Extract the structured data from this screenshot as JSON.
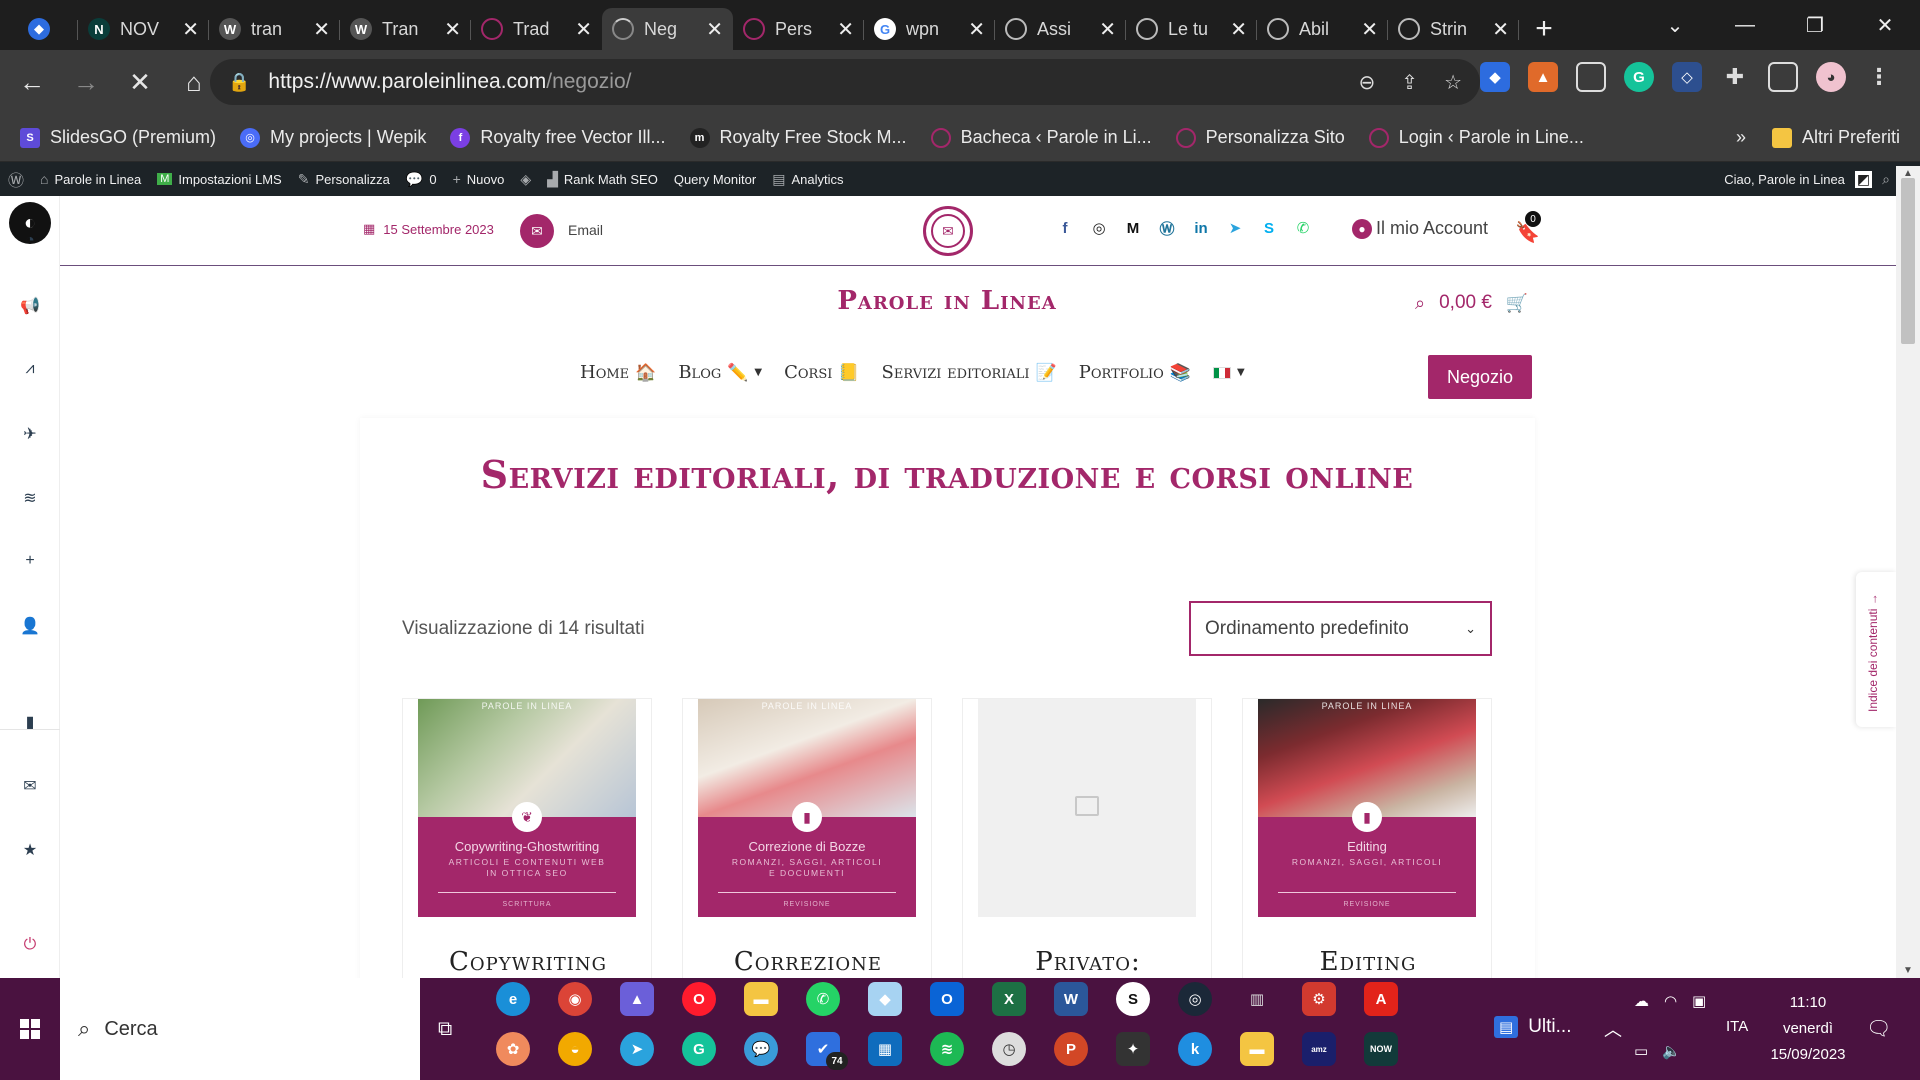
{
  "browser": {
    "tabs": [
      {
        "title": "",
        "icon": "gem-icon",
        "color": "#2d6cdf"
      },
      {
        "title": "NOV",
        "icon": "notion-n-icon",
        "color": "#0a3d3a"
      },
      {
        "title": "tran",
        "icon": "wordpress-icon",
        "color": "#555"
      },
      {
        "title": "Tran",
        "icon": "wordpress-icon",
        "color": "#555"
      },
      {
        "title": "Trad",
        "icon": "parole-logo-icon",
        "color": "#a3276a"
      },
      {
        "title": "Neg",
        "icon": "loading-spinner-icon",
        "color": "#777",
        "active": true
      },
      {
        "title": "Pers",
        "icon": "parole-logo-icon",
        "color": "#a3276a"
      },
      {
        "title": "wpn",
        "icon": "google-icon",
        "color": "#4285f4"
      },
      {
        "title": "Assi",
        "icon": "openai-icon",
        "color": "#444"
      },
      {
        "title": "Le tu",
        "icon": "openai-icon",
        "color": "#444"
      },
      {
        "title": "Abil",
        "icon": "openai-icon",
        "color": "#444"
      },
      {
        "title": "Strin",
        "icon": "openai-icon",
        "color": "#444"
      }
    ],
    "url_host": "https://www.paroleinlinea.com",
    "url_path": "/negozio/",
    "bookmarks": [
      {
        "label": "SlidesGO (Premium)",
        "color": "#5e4bd8"
      },
      {
        "label": "My projects | Wepik",
        "color": "#4a6cf7"
      },
      {
        "label": "Royalty free Vector Ill...",
        "color": "#7b3fe4"
      },
      {
        "label": "Royalty Free Stock M...",
        "color": "#222"
      },
      {
        "label": "Bacheca ‹ Parole in Li...",
        "color": "#a3276a"
      },
      {
        "label": "Personalizza Sito",
        "color": "#a3276a"
      },
      {
        "label": "Login ‹ Parole in Line...",
        "color": "#a3276a"
      }
    ],
    "bookmarks_overflow": "»",
    "other_bookmarks": "Altri Preferiti"
  },
  "wpbar": {
    "site": "Parole in Linea",
    "lms": "Impostazioni LMS",
    "customize": "Personalizza",
    "comments": "0",
    "new": "Nuovo",
    "rankmath": "Rank Math SEO",
    "querymonitor": "Query Monitor",
    "analytics": "Analytics",
    "greeting": "Ciao, Parole in Linea"
  },
  "site": {
    "date": "15 Settembre 2023",
    "email": "Email",
    "account": "Il mio Account",
    "wishlist_count": "0",
    "brand": "Parole in Linea",
    "cart_amount": "0,00 €",
    "nav": [
      {
        "label": "Home",
        "emoji": "🏠"
      },
      {
        "label": "Blog",
        "emoji": "✏️",
        "dropdown": true
      },
      {
        "label": "Corsi",
        "emoji": "📒"
      },
      {
        "label": "Servizi editoriali",
        "emoji": "📝"
      },
      {
        "label": "Portfolio",
        "emoji": "📚"
      }
    ],
    "shop_button": "Negozio",
    "page_title": "Servizi editoriali, di traduzione e corsi online",
    "results": "Visualizzazione di 14 risultati",
    "sort_selected": "Ordinamento predefinito",
    "toc_label": "Indice dei contenuti",
    "products": [
      {
        "name": "Copywriting",
        "img_brand": "PAROLE IN LINEA",
        "img_title": "Copywriting-Ghostwriting",
        "img_sub": "ARTICOLI E CONTENUTI WEB IN OTTICA SEO",
        "img_cat": "SCRITTURA",
        "badge": "quill-icon",
        "photo": "#9bb37a"
      },
      {
        "name": "Correzione",
        "img_brand": "PAROLE IN LINEA",
        "img_title": "Correzione di Bozze",
        "img_sub": "ROMANZI, SAGGI, ARTICOLI E DOCUMENTI",
        "img_cat": "REVISIONE",
        "badge": "book-icon",
        "photo": "#e7d7c8"
      },
      {
        "name": "Privato:",
        "placeholder": true
      },
      {
        "name": "Editing",
        "img_brand": "PAROLE IN LINEA",
        "img_title": "Editing",
        "img_sub": "ROMANZI, SAGGI, ARTICOLI",
        "img_cat": "REVISIONE",
        "badge": "book-icon",
        "photo": "#c94a52"
      }
    ]
  },
  "taskbar": {
    "search_placeholder": "Cerca",
    "news": "Ulti...",
    "lang": "ITA",
    "time": "11:10",
    "day": "venerdì",
    "date": "15/09/2023",
    "badge_74": "74"
  }
}
